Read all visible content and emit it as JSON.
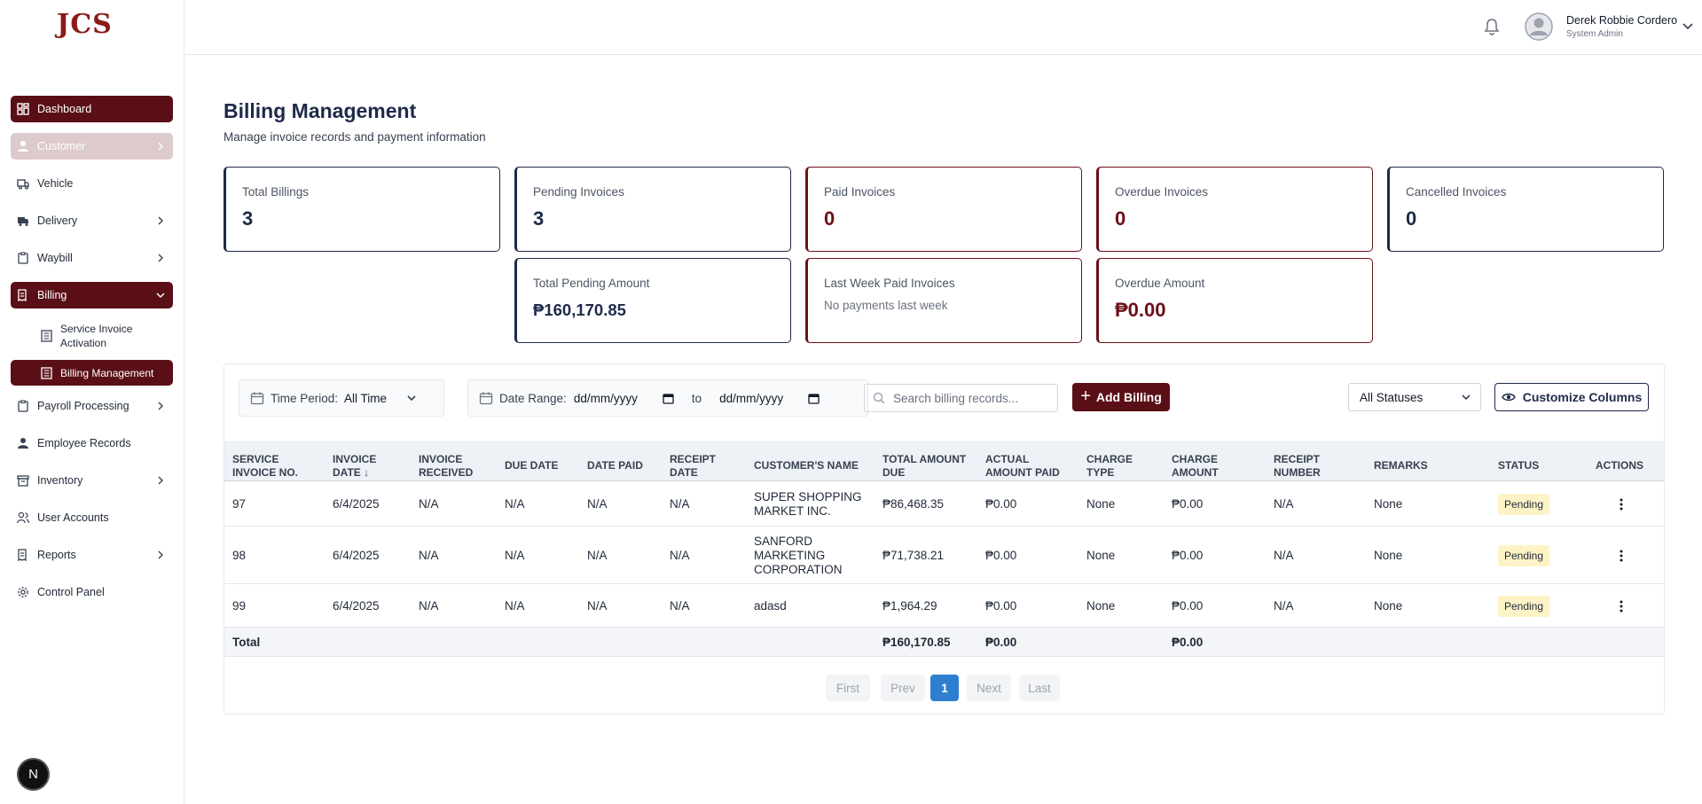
{
  "sidebar": {
    "logo": "JCS",
    "items": [
      {
        "label": "Dashboard"
      },
      {
        "label": "Customer"
      },
      {
        "label": "Vehicle"
      },
      {
        "label": "Delivery"
      },
      {
        "label": "Waybill"
      },
      {
        "label": "Billing"
      },
      {
        "label": "Service Invoice Activation"
      },
      {
        "label": "Billing Management"
      },
      {
        "label": "Payroll Processing"
      },
      {
        "label": "Employee Records"
      },
      {
        "label": "Inventory"
      },
      {
        "label": "User Accounts"
      },
      {
        "label": "Reports"
      },
      {
        "label": "Control Panel"
      }
    ],
    "badge": "N"
  },
  "header": {
    "user_name": "Derek Robbie Cordero",
    "user_role": "System Admin"
  },
  "page": {
    "title": "Billing Management",
    "subtitle": "Manage invoice records and payment information"
  },
  "stats": {
    "total_billings": {
      "label": "Total Billings",
      "value": "3"
    },
    "pending_invoices": {
      "label": "Pending Invoices",
      "value": "3"
    },
    "paid_invoices": {
      "label": "Paid Invoices",
      "value": "0"
    },
    "overdue_invoices": {
      "label": "Overdue Invoices",
      "value": "0"
    },
    "cancelled_invoices": {
      "label": "Cancelled Invoices",
      "value": "0"
    },
    "total_pending_amount": {
      "label": "Total Pending Amount",
      "value": "₱160,170.85"
    },
    "last_week_paid": {
      "label": "Last Week Paid Invoices",
      "note": "No payments last week"
    },
    "overdue_amount": {
      "label": "Overdue Amount",
      "value": "₱0.00"
    }
  },
  "filters": {
    "time_period_label": "Time Period:",
    "time_period_value": "All Time",
    "date_range_label": "Date Range:",
    "date_from": "dd/mm/yyyy",
    "date_to_label": "to",
    "date_to": "dd/mm/yyyy",
    "search_placeholder": "Search billing records...",
    "add_label": "Add Billing",
    "status_value": "All Statuses",
    "customize_label": "Customize Columns"
  },
  "table": {
    "columns": [
      {
        "line1": "SERVICE",
        "line2": "INVOICE NO."
      },
      {
        "line1": "INVOICE",
        "line2": "DATE ↓"
      },
      {
        "line1": "INVOICE",
        "line2": "RECEIVED"
      },
      {
        "line1": "DUE DATE",
        "line2": ""
      },
      {
        "line1": "DATE PAID",
        "line2": ""
      },
      {
        "line1": "RECEIPT",
        "line2": "DATE"
      },
      {
        "line1": "CUSTOMER'S NAME",
        "line2": ""
      },
      {
        "line1": "TOTAL AMOUNT",
        "line2": "DUE"
      },
      {
        "line1": "ACTUAL",
        "line2": "AMOUNT PAID"
      },
      {
        "line1": "CHARGE",
        "line2": "TYPE"
      },
      {
        "line1": "CHARGE",
        "line2": "AMOUNT"
      },
      {
        "line1": "RECEIPT",
        "line2": "NUMBER"
      },
      {
        "line1": "REMARKS",
        "line2": ""
      },
      {
        "line1": "STATUS",
        "line2": ""
      },
      {
        "line1": "ACTIONS",
        "line2": ""
      }
    ],
    "rows": [
      {
        "invoice_no": "97",
        "invoice_date": "6/4/2025",
        "received": "N/A",
        "due": "N/A",
        "paid": "N/A",
        "receipt_date": "N/A",
        "customer_l1": "SUPER SHOPPING",
        "customer_l2": "MARKET INC.",
        "customer_l3": "",
        "total_due": "₱86,468.35",
        "actual_paid": "₱0.00",
        "charge_type": "None",
        "charge_amount": "₱0.00",
        "receipt_no": "N/A",
        "remarks": "None",
        "status": "Pending"
      },
      {
        "invoice_no": "98",
        "invoice_date": "6/4/2025",
        "received": "N/A",
        "due": "N/A",
        "paid": "N/A",
        "receipt_date": "N/A",
        "customer_l1": "SANFORD",
        "customer_l2": "MARKETING",
        "customer_l3": "CORPORATION",
        "total_due": "₱71,738.21",
        "actual_paid": "₱0.00",
        "charge_type": "None",
        "charge_amount": "₱0.00",
        "receipt_no": "N/A",
        "remarks": "None",
        "status": "Pending"
      },
      {
        "invoice_no": "99",
        "invoice_date": "6/4/2025",
        "received": "N/A",
        "due": "N/A",
        "paid": "N/A",
        "receipt_date": "N/A",
        "customer_l1": "adasd",
        "customer_l2": "",
        "customer_l3": "",
        "total_due": "₱1,964.29",
        "actual_paid": "₱0.00",
        "charge_type": "None",
        "charge_amount": "₱0.00",
        "receipt_no": "N/A",
        "remarks": "None",
        "status": "Pending"
      }
    ],
    "total": {
      "label": "Total",
      "total_due": "₱160,170.85",
      "actual_paid": "₱0.00",
      "charge_amount": "₱0.00"
    }
  },
  "pagination": {
    "first": "First",
    "prev": "Prev",
    "current": "1",
    "next": "Next",
    "last": "Last"
  },
  "colors": {
    "primary": "#5a0f16",
    "navy": "#1e2a4a",
    "pending_bg": "#fef3c7",
    "page_active": "#2f7fd1"
  }
}
